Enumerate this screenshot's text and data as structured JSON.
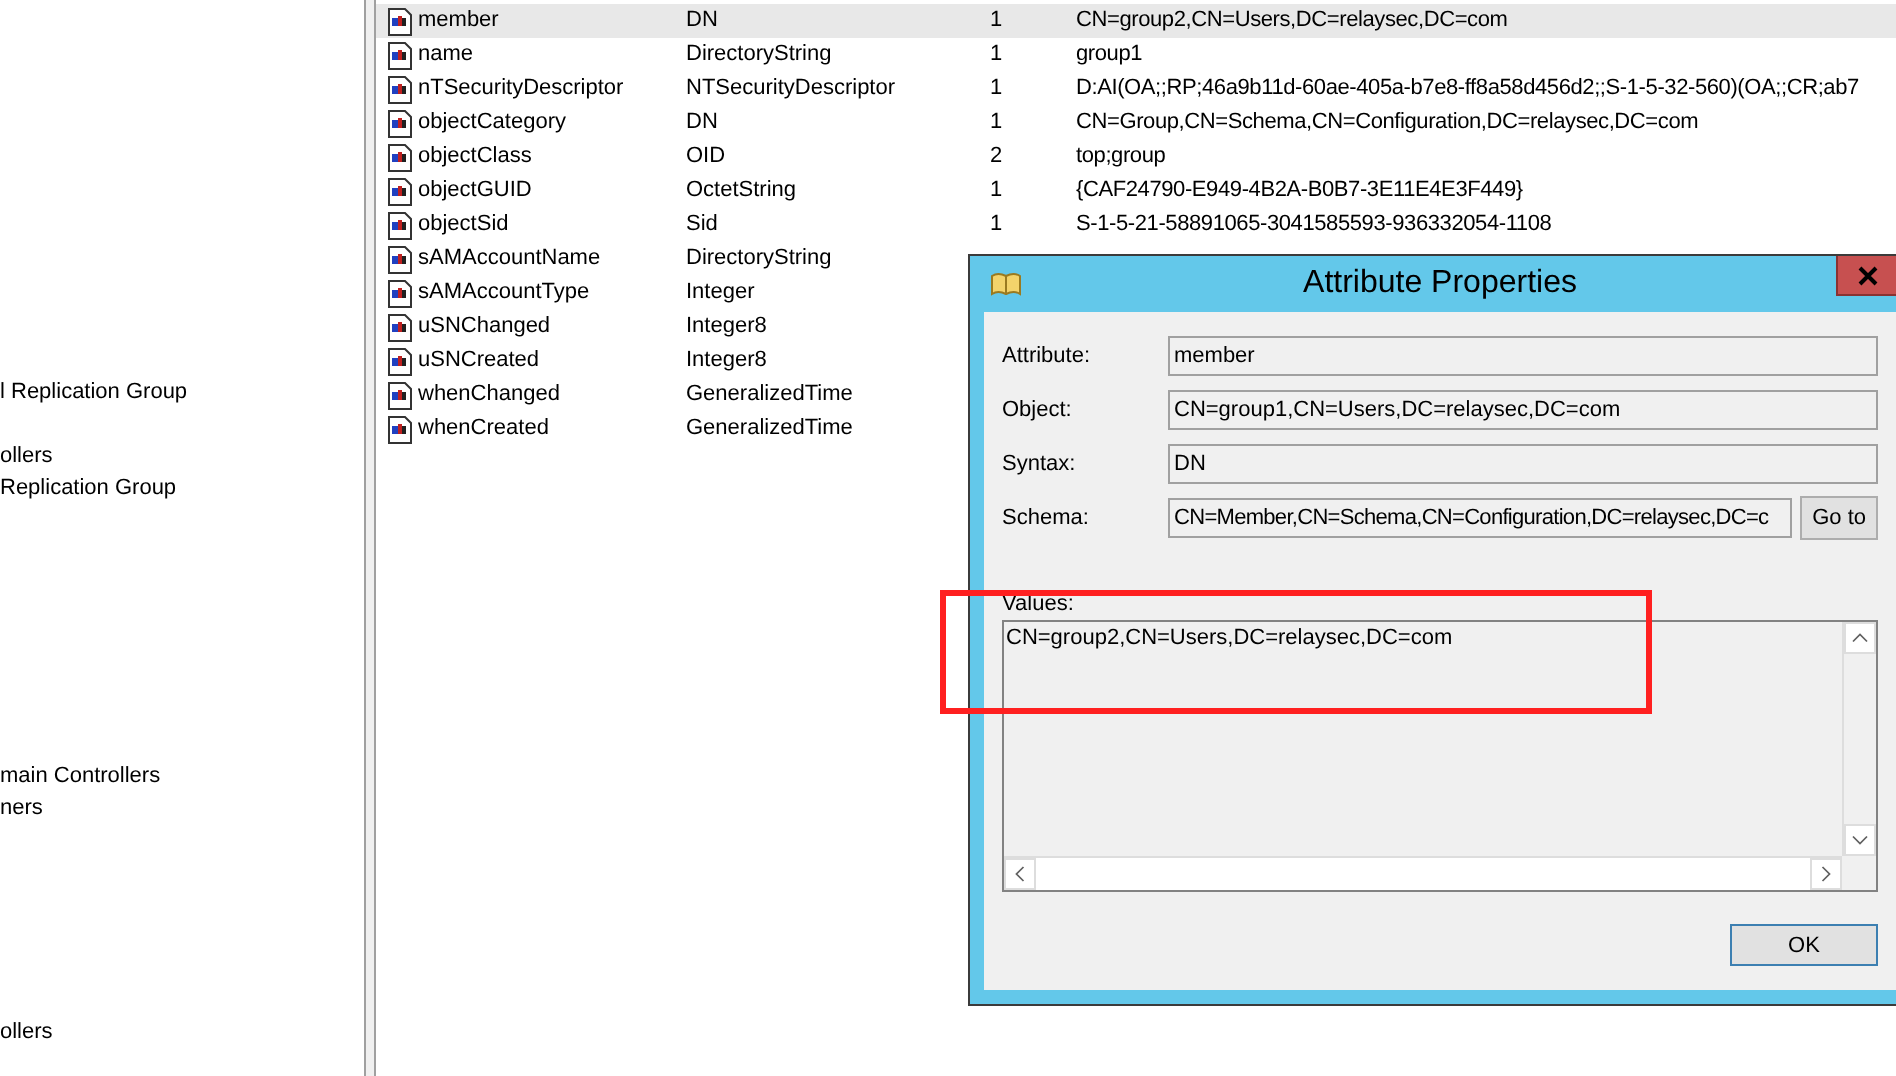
{
  "tree": {
    "items": [
      "l Replication Group",
      "ollers",
      "Replication Group",
      "main Controllers",
      "ners",
      "ollers"
    ]
  },
  "attributes": [
    {
      "name": "member",
      "syntax": "DN",
      "count": "1",
      "value": "CN=group2,CN=Users,DC=relaysec,DC=com",
      "selected": true
    },
    {
      "name": "name",
      "syntax": "DirectoryString",
      "count": "1",
      "value": "group1",
      "selected": false
    },
    {
      "name": "nTSecurityDescriptor",
      "syntax": "NTSecurityDescriptor",
      "count": "1",
      "value": "D:AI(OA;;RP;46a9b11d-60ae-405a-b7e8-ff8a58d456d2;;S-1-5-32-560)(OA;;CR;ab7",
      "selected": false
    },
    {
      "name": "objectCategory",
      "syntax": "DN",
      "count": "1",
      "value": "CN=Group,CN=Schema,CN=Configuration,DC=relaysec,DC=com",
      "selected": false
    },
    {
      "name": "objectClass",
      "syntax": "OID",
      "count": "2",
      "value": "top;group",
      "selected": false
    },
    {
      "name": "objectGUID",
      "syntax": "OctetString",
      "count": "1",
      "value": "{CAF24790-E949-4B2A-B0B7-3E11E4E3F449}",
      "selected": false
    },
    {
      "name": "objectSid",
      "syntax": "Sid",
      "count": "1",
      "value": "S-1-5-21-58891065-3041585593-936332054-1108",
      "selected": false
    },
    {
      "name": "sAMAccountName",
      "syntax": "DirectoryString",
      "selected": false
    },
    {
      "name": "sAMAccountType",
      "syntax": "Integer",
      "selected": false
    },
    {
      "name": "uSNChanged",
      "syntax": "Integer8",
      "selected": false
    },
    {
      "name": "uSNCreated",
      "syntax": "Integer8",
      "selected": false
    },
    {
      "name": "whenChanged",
      "syntax": "GeneralizedTime",
      "selected": false
    },
    {
      "name": "whenCreated",
      "syntax": "GeneralizedTime",
      "selected": false
    }
  ],
  "dialog": {
    "title": "Attribute Properties",
    "fields": [
      {
        "kind": "text",
        "label": "Attribute:",
        "value": "member"
      },
      {
        "kind": "text",
        "label": "Object:",
        "value": "CN=group1,CN=Users,DC=relaysec,DC=com"
      },
      {
        "kind": "text",
        "label": "Syntax:",
        "value": "DN"
      },
      {
        "kind": "text_button",
        "label": "Schema:",
        "value": "CN=Member,CN=Schema,CN=Configuration,DC=relaysec,DC=c",
        "button": "Go to"
      }
    ],
    "values_label": "Values:",
    "values": [
      "CN=group2,CN=Users,DC=relaysec,DC=com"
    ],
    "ok": "OK"
  }
}
